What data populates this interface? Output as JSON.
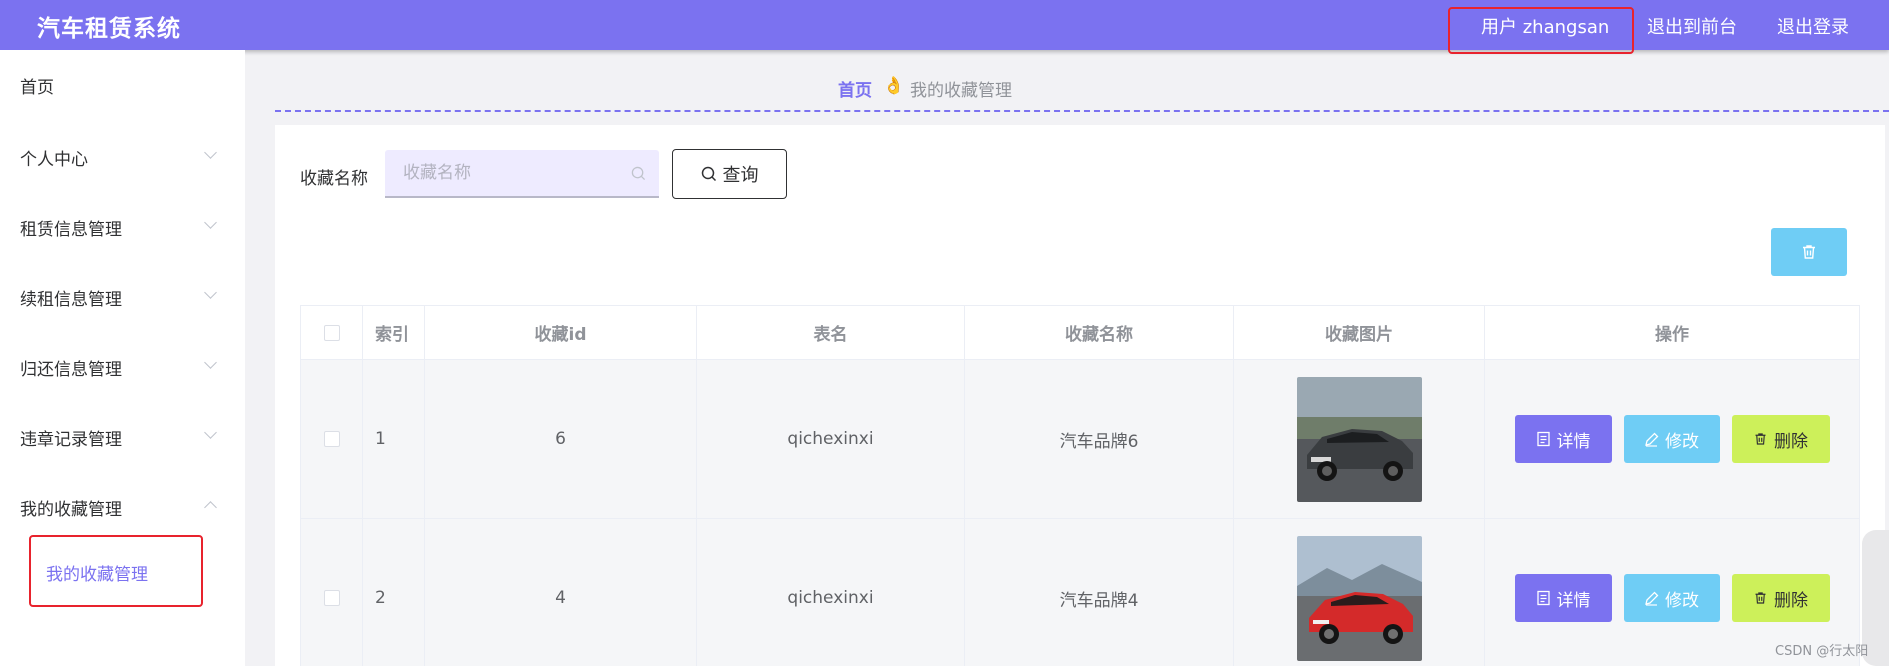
{
  "header": {
    "brand": "汽车租赁系统",
    "user_label": "用户 zhangsan",
    "to_front": "退出到前台",
    "logout": "退出登录"
  },
  "sidebar": {
    "items": [
      {
        "label": "首页"
      },
      {
        "label": "个人中心"
      },
      {
        "label": "租赁信息管理"
      },
      {
        "label": "续租信息管理"
      },
      {
        "label": "归还信息管理"
      },
      {
        "label": "违章记录管理"
      },
      {
        "label": "我的收藏管理"
      }
    ],
    "sub_item": "我的收藏管理"
  },
  "breadcrumb": {
    "home": "首页",
    "hand": "👌",
    "current": "我的收藏管理"
  },
  "search": {
    "label": "收藏名称",
    "placeholder": "收藏名称",
    "query_label": "查询"
  },
  "table": {
    "headers": [
      "索引",
      "收藏id",
      "表名",
      "收藏名称",
      "收藏图片",
      "操作"
    ],
    "rows": [
      {
        "index": "1",
        "id": "6",
        "table_name": "qichexinxi",
        "name": "汽车品牌6",
        "image": "gray-muscle-car"
      },
      {
        "index": "2",
        "id": "4",
        "table_name": "qichexinxi",
        "name": "汽车品牌4",
        "image": "red-sports-car"
      }
    ],
    "actions": {
      "detail": "详情",
      "edit": "修改",
      "delete": "删除"
    }
  },
  "watermark": "CSDN @行太阳",
  "colors": {
    "primary": "#7b72f0",
    "info": "#6fcdf5",
    "lime": "#cdf05a",
    "highlight": "#e8232d"
  }
}
